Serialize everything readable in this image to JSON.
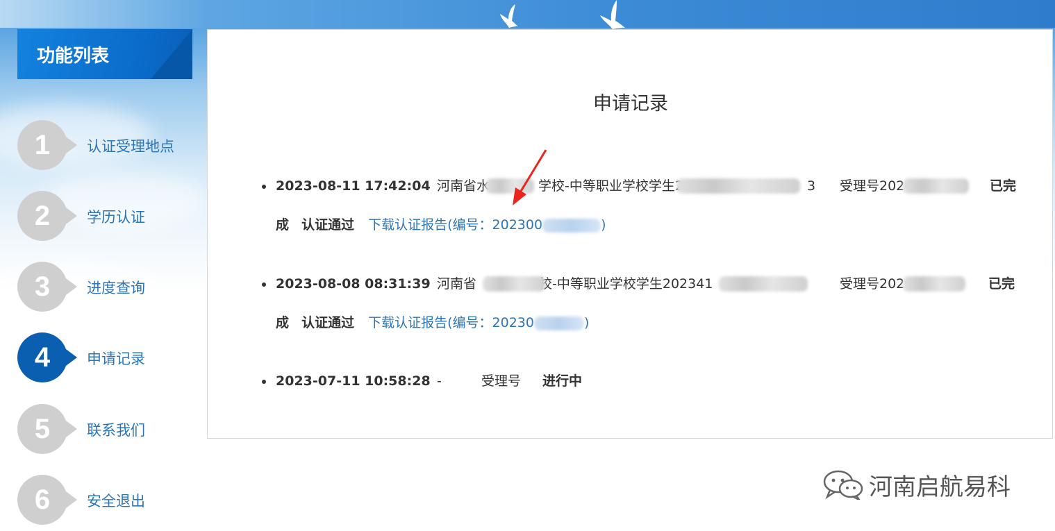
{
  "sidebar": {
    "title": "功能列表",
    "items": [
      {
        "num": "1",
        "label": "认证受理地点"
      },
      {
        "num": "2",
        "label": "学历认证"
      },
      {
        "num": "3",
        "label": "进度查询"
      },
      {
        "num": "4",
        "label": "申请记录"
      },
      {
        "num": "5",
        "label": "联系我们"
      },
      {
        "num": "6",
        "label": "安全退出"
      }
    ],
    "active_index": 3
  },
  "main": {
    "title": "申请记录",
    "records": [
      {
        "datetime": "2023-08-11 17:42:04",
        "school_prefix": "河南省水",
        "school_mid": "学校-中等职业学校学生2",
        "school_suffix": "3",
        "accept_label": "受理号202",
        "status_part1": "已完",
        "status_part2": "成",
        "result": "认证通过",
        "download_label": "下载认证报告(编号：202300",
        "download_close": ")"
      },
      {
        "datetime": "2023-08-08 08:31:39",
        "school_prefix": "河南省",
        "school_mid": "校-中等职业学校学生202341",
        "school_suffix": "",
        "accept_label": "受理号202",
        "status_part1": "已完",
        "status_part2": "成",
        "result": "认证通过",
        "download_label": "下载认证报告(编号：20230",
        "download_close": ")"
      },
      {
        "datetime": "2023-07-11 10:58:28",
        "school": "-",
        "accept_label": "受理号",
        "status": "进行中"
      }
    ]
  },
  "watermark": {
    "text": "河南启航易科",
    "icon": "wechat-icon"
  },
  "colors": {
    "accent": "#0a5fb0",
    "link": "#2e75b6",
    "inactive_circle": "#cfcfcf",
    "arrow": "#e8261f"
  }
}
